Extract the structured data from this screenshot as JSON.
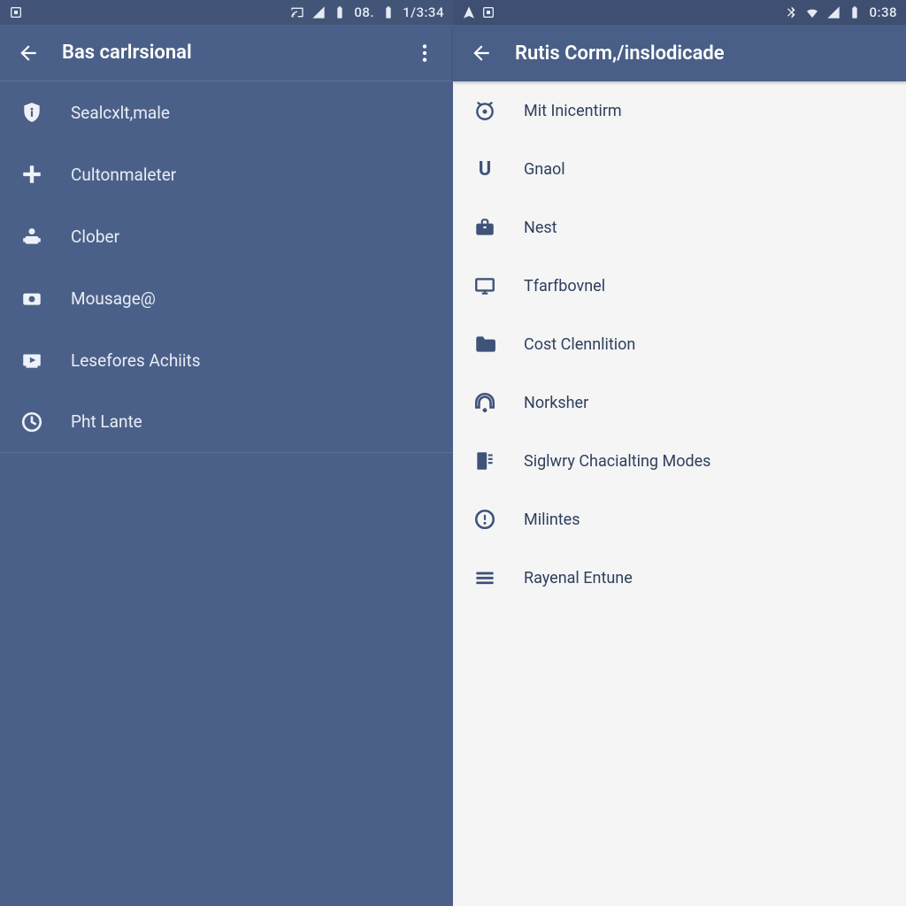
{
  "left": {
    "status": {
      "battery_pct": "08.",
      "clock": "1/3:34"
    },
    "appbar": {
      "title": "Bas carlrsional"
    },
    "items": [
      {
        "icon": "shield-info-icon",
        "label": "Sealcxlt,male"
      },
      {
        "icon": "plus-icon",
        "label": "Cultonmaleter"
      },
      {
        "icon": "person-camera-icon",
        "label": "Clober"
      },
      {
        "icon": "camera-icon",
        "label": "Mousage@"
      },
      {
        "icon": "video-board-icon",
        "label": "Lesefores Achiits"
      },
      {
        "icon": "clock-icon",
        "label": "Pht Lante"
      }
    ]
  },
  "right": {
    "status": {
      "clock": "0:38"
    },
    "appbar": {
      "title": "Rutis Corm,/inslodicade"
    },
    "items": [
      {
        "icon": "alarm-target-icon",
        "label": "Mit Inicentirm"
      },
      {
        "icon": "letter-u-icon",
        "label": "Gnaol"
      },
      {
        "icon": "briefcase-icon",
        "label": "Nest"
      },
      {
        "icon": "monitor-icon",
        "label": "Tfarfbovnel"
      },
      {
        "icon": "folder-icon",
        "label": "Cost Clennlition"
      },
      {
        "icon": "headset-ring-icon",
        "label": "Norksher"
      },
      {
        "icon": "book-lines-icon",
        "label": "Siglwry Chacialting Modes"
      },
      {
        "icon": "alert-circle-icon",
        "label": "Milintes"
      },
      {
        "icon": "menu-lines-icon",
        "label": "Rayenal Entune"
      }
    ]
  }
}
